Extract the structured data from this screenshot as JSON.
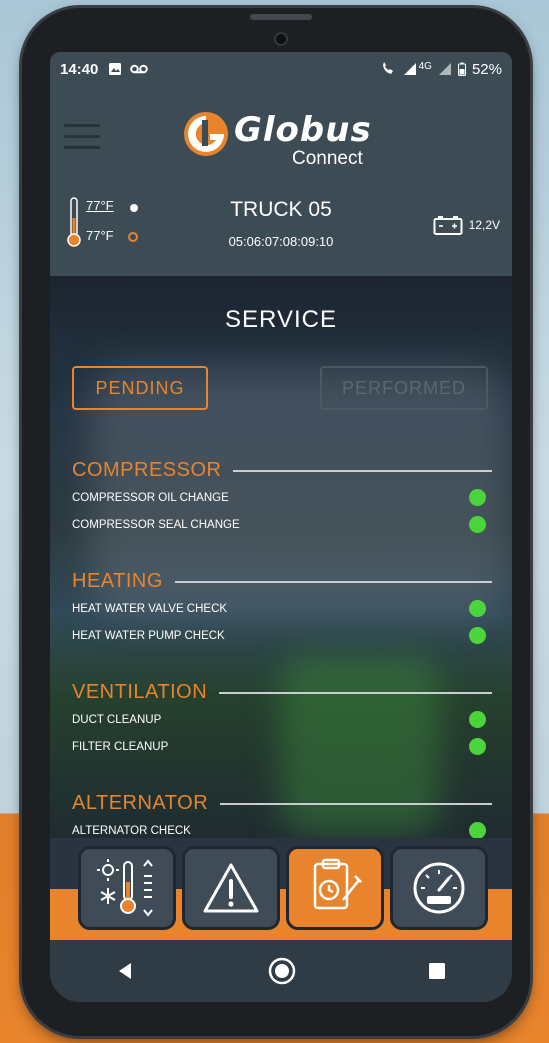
{
  "status_bar": {
    "time": "14:40",
    "network": "4G",
    "battery_percent": "52%"
  },
  "header": {
    "logo_text": "Globus",
    "logo_subtext": "Connect",
    "temp_outside": "77°F",
    "temp_inside": "77°F",
    "truck_name": "TRUCK 05",
    "truck_id": "05:06:07:08:09:10",
    "battery_voltage": "12,2V"
  },
  "page": {
    "title": "SERVICE",
    "tabs": [
      {
        "label": "PENDING",
        "active": true
      },
      {
        "label": "PERFORMED",
        "active": false
      }
    ]
  },
  "groups": [
    {
      "title": "COMPRESSOR",
      "items": [
        "COMPRESSOR OIL CHANGE",
        "COMPRESSOR SEAL CHANGE"
      ]
    },
    {
      "title": "HEATING",
      "items": [
        "HEAT WATER VALVE CHECK",
        "HEAT WATER PUMP CHECK"
      ]
    },
    {
      "title": "VENTILATION",
      "items": [
        "DUCT CLEANUP",
        "FILTER CLEANUP"
      ]
    },
    {
      "title": "ALTERNATOR",
      "items": [
        "ALTERNATOR CHECK"
      ]
    }
  ],
  "colors": {
    "accent": "#e8842c",
    "status_ok": "#4cd43c",
    "header_bg": "#3d4b55"
  },
  "bottom_nav": [
    {
      "icon": "climate-icon",
      "active": false
    },
    {
      "icon": "warning-icon",
      "active": false
    },
    {
      "icon": "service-icon",
      "active": true
    },
    {
      "icon": "gauge-icon",
      "active": false
    }
  ]
}
